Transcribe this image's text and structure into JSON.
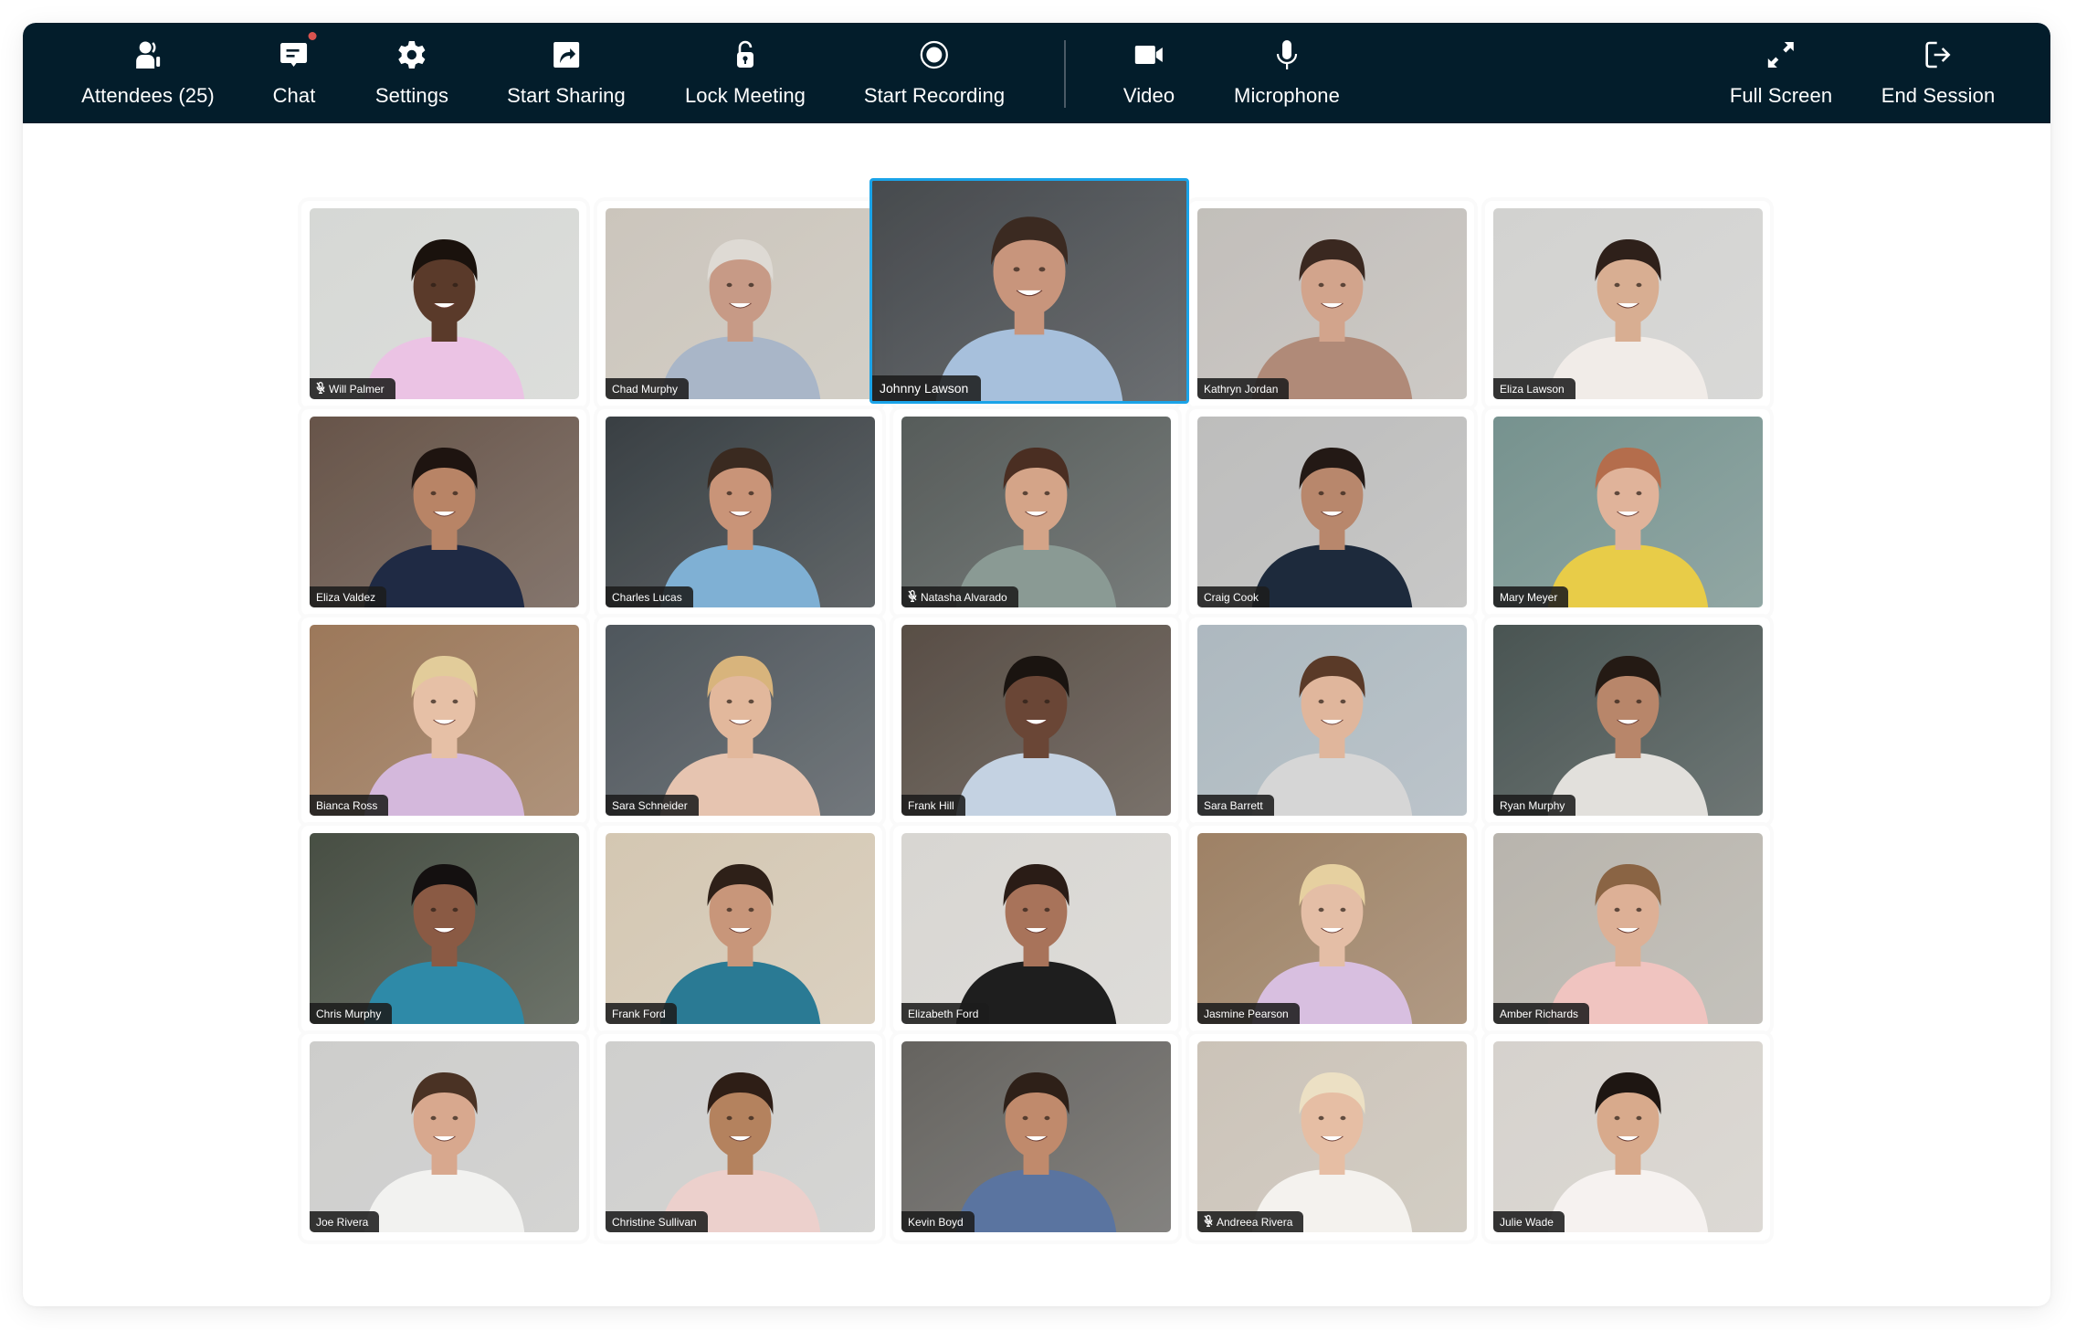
{
  "toolbar": {
    "background": "#031d2b",
    "left_items": [
      {
        "id": "attendees",
        "label": "Attendees (25)",
        "icon": "attendees-icon"
      },
      {
        "id": "chat",
        "label": "Chat",
        "icon": "chat-icon",
        "has_notification": true,
        "notification_color": "#d9534f"
      },
      {
        "id": "settings",
        "label": "Settings",
        "icon": "gear-icon"
      },
      {
        "id": "start-sharing",
        "label": "Start Sharing",
        "icon": "share-screen-icon"
      },
      {
        "id": "lock-meeting",
        "label": "Lock Meeting",
        "icon": "unlock-icon"
      },
      {
        "id": "start-recording",
        "label": "Start Recording",
        "icon": "record-icon"
      }
    ],
    "media_items": [
      {
        "id": "video",
        "label": "Video",
        "icon": "video-camera-icon"
      },
      {
        "id": "microphone",
        "label": "Microphone",
        "icon": "microphone-icon"
      }
    ],
    "right_items": [
      {
        "id": "full-screen",
        "label": "Full Screen",
        "icon": "expand-icon"
      },
      {
        "id": "end-session",
        "label": "End Session",
        "icon": "exit-icon"
      }
    ]
  },
  "active_speaker_color": "#1aa3e8",
  "participants": [
    {
      "name": "Will Palmer",
      "muted": true,
      "active": false,
      "bg": "#e4e6e3",
      "skin": "#5a3a2a",
      "hair": "#1a120d",
      "shirt": "#ebc3e4"
    },
    {
      "name": "Chad Murphy",
      "muted": false,
      "active": false,
      "bg": "#d8d2c8",
      "skin": "#c79a86",
      "hair": "#dedad4",
      "shirt": "#a9b6c8"
    },
    {
      "name": "Johnny Lawson",
      "muted": false,
      "active": true,
      "bg": "#4b4f53",
      "skin": "#c8957c",
      "hair": "#3b2a21",
      "shirt": "#a7c0dc"
    },
    {
      "name": "Kathryn Jordan",
      "muted": false,
      "active": false,
      "bg": "#cfcbc6",
      "skin": "#d2a48c",
      "hair": "#3a2820",
      "shirt": "#b08a78"
    },
    {
      "name": "Eliza Lawson",
      "muted": false,
      "active": false,
      "bg": "#e0e0de",
      "skin": "#d8ae92",
      "hair": "#2e201a",
      "shirt": "#f1ece8"
    },
    {
      "name": "Eliza Valdez",
      "muted": false,
      "active": false,
      "bg": "#6e5a4e",
      "skin": "#b88466",
      "hair": "#1e1410",
      "shirt": "#1f2a44"
    },
    {
      "name": "Charles Lucas",
      "muted": false,
      "active": false,
      "bg": "#3d4448",
      "skin": "#c99478",
      "hair": "#3a2a20",
      "shirt": "#7fb0d4"
    },
    {
      "name": "Natasha Alvarado",
      "muted": true,
      "active": false,
      "bg": "#5c6260",
      "skin": "#d4a488",
      "hair": "#4a2e22",
      "shirt": "#8a9a94"
    },
    {
      "name": "Craig Cook",
      "muted": false,
      "active": false,
      "bg": "#c9c9c8",
      "skin": "#b8876c",
      "hair": "#231915",
      "shirt": "#1d2a3c"
    },
    {
      "name": "Mary Meyer",
      "muted": false,
      "active": false,
      "bg": "#7e9c98",
      "skin": "#e0b39a",
      "hair": "#b46d4c",
      "shirt": "#e8cc48"
    },
    {
      "name": "Bianca Ross",
      "muted": false,
      "active": false,
      "bg": "#a68060",
      "skin": "#e6c0a6",
      "hair": "#e2cc9a",
      "shirt": "#d4b8dc"
    },
    {
      "name": "Sara Schneider",
      "muted": false,
      "active": false,
      "bg": "#545c62",
      "skin": "#e2b89c",
      "hair": "#d8b47c",
      "shirt": "#e6c4b0"
    },
    {
      "name": "Frank Hill",
      "muted": false,
      "active": false,
      "bg": "#5e534a",
      "skin": "#6a4636",
      "hair": "#1a1410",
      "shirt": "#c4d2e2"
    },
    {
      "name": "Sara Barrett",
      "muted": false,
      "active": false,
      "bg": "#b8c4cc",
      "skin": "#e0b69c",
      "hair": "#5a3a28",
      "shirt": "#d6d6d6"
    },
    {
      "name": "Ryan Murphy",
      "muted": false,
      "active": false,
      "bg": "#4e5a58",
      "skin": "#b8866a",
      "hair": "#241a14",
      "shirt": "#e2e0dc"
    },
    {
      "name": "Chris Murphy",
      "muted": false,
      "active": false,
      "bg": "#4c5448",
      "skin": "#8a5a44",
      "hair": "#141010",
      "shirt": "#2e8aa8"
    },
    {
      "name": "Frank Ford",
      "muted": false,
      "active": false,
      "bg": "#e2d4be",
      "skin": "#c8967a",
      "hair": "#2e2018",
      "shirt": "#2a7a94"
    },
    {
      "name": "Elizabeth Ford",
      "muted": false,
      "active": false,
      "bg": "#e6e4e0",
      "skin": "#a8735a",
      "hair": "#2a1c16",
      "shirt": "#1e1e1e"
    },
    {
      "name": "Jasmine Pearson",
      "muted": false,
      "active": false,
      "bg": "#a88a6c",
      "skin": "#e4bea6",
      "hair": "#e6d0a0",
      "shirt": "#d8bfe0"
    },
    {
      "name": "Amber Richards",
      "muted": false,
      "active": false,
      "bg": "#c4c0b8",
      "skin": "#ddb096",
      "hair": "#8a6444",
      "shirt": "#f0c4c0"
    },
    {
      "name": "Joe Rivera",
      "muted": false,
      "active": false,
      "bg": "#dadad8",
      "skin": "#d8a88e",
      "hair": "#4a3224",
      "shirt": "#f2f2f0"
    },
    {
      "name": "Christine Sullivan",
      "muted": false,
      "active": false,
      "bg": "#dcdcda",
      "skin": "#b4825e",
      "hair": "#2e1e16",
      "shirt": "#ecd0cc"
    },
    {
      "name": "Kevin Boyd",
      "muted": false,
      "active": false,
      "bg": "#6c6a66",
      "skin": "#c08a6c",
      "hair": "#2e2018",
      "shirt": "#5a74a0"
    },
    {
      "name": "Andreea Rivera",
      "muted": true,
      "active": false,
      "bg": "#d8d0c4",
      "skin": "#e6bea4",
      "hair": "#ece0c4",
      "shirt": "#f4f2ee"
    },
    {
      "name": "Julie Wade",
      "muted": false,
      "active": false,
      "bg": "#e4e0da",
      "skin": "#d8aa8c",
      "hair": "#1e1612",
      "shirt": "#f6f2f0"
    }
  ]
}
